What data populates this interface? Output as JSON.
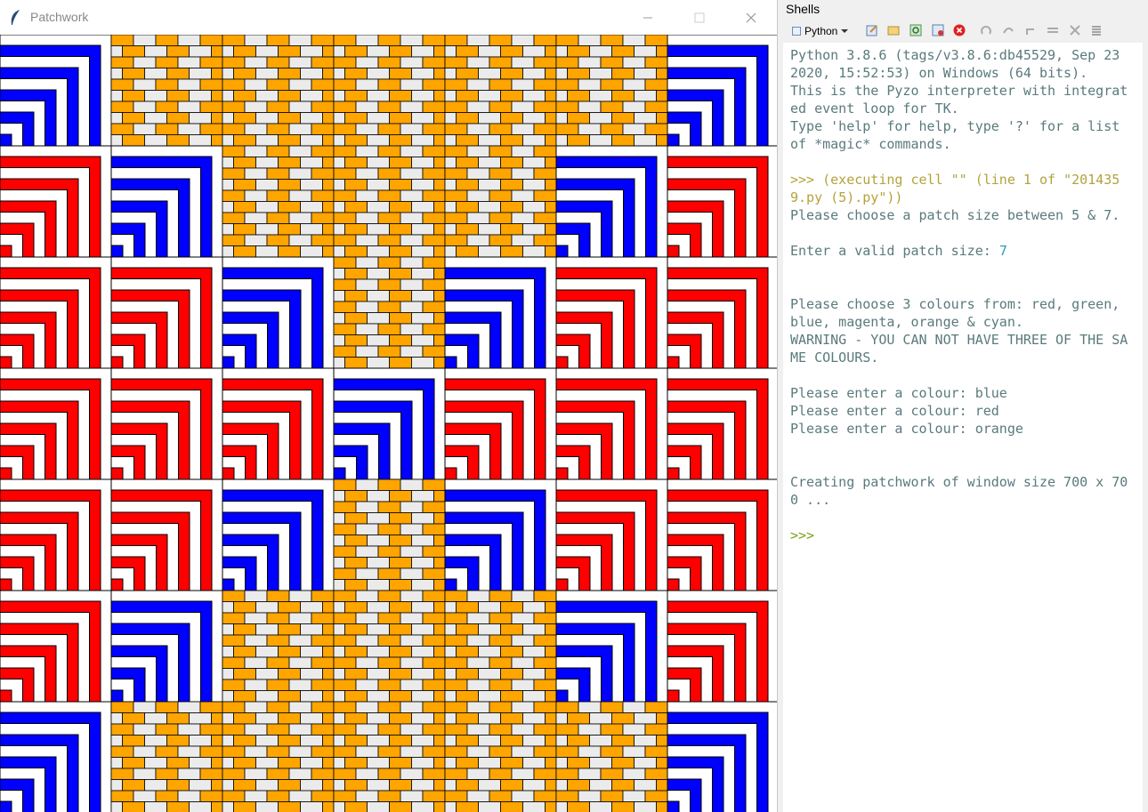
{
  "tk": {
    "title": "Patchwork",
    "controls": {
      "minimize": "—",
      "maximize": "☐",
      "close": "✕"
    }
  },
  "patchwork": {
    "rows": 7,
    "cols": 7,
    "colours": {
      "blue": "#0000ff",
      "red": "#ff0000",
      "orange": "#ffa500",
      "white": "#ffffff",
      "brick_light": "#ebebeb"
    },
    "layout": [
      [
        "L-blue",
        "B",
        "B",
        "B",
        "B",
        "B",
        "L-blue"
      ],
      [
        "L-red",
        "L-blue",
        "B",
        "B",
        "B",
        "L-blue",
        "L-red"
      ],
      [
        "L-red",
        "L-red",
        "L-blue",
        "B",
        "L-blue",
        "L-red",
        "L-red"
      ],
      [
        "L-red",
        "L-red",
        "L-red",
        "L-blue",
        "L-red",
        "L-red",
        "L-red"
      ],
      [
        "L-red",
        "L-red",
        "L-blue",
        "B",
        "L-blue",
        "L-red",
        "L-red"
      ],
      [
        "L-red",
        "L-blue",
        "B",
        "B",
        "B",
        "L-blue",
        "L-red"
      ],
      [
        "L-blue",
        "B",
        "B",
        "B",
        "B",
        "B",
        "L-blue"
      ]
    ]
  },
  "shells": {
    "title": "Shells",
    "shell_name": "Python",
    "toolbar_icons": [
      "edit-icon",
      "folder-icon",
      "refresh-icon",
      "new-shell-icon",
      "stop-icon",
      "interrupt-icon",
      "step-over-icon",
      "step-out-icon",
      "continue-icon",
      "clear-icon",
      "list-icon"
    ],
    "lines": [
      {
        "t": "Python 3.8.6 (tags/v3.8.6:db45529, Sep 23 2020, 15:52:53) on Windows (64 bits).",
        "c": ""
      },
      {
        "t": "This is the Pyzo interpreter with integrated event loop for TK.",
        "c": ""
      },
      {
        "t": "Type 'help' for help, type '?' for a list of *magic* commands.",
        "c": ""
      },
      {
        "t": "",
        "c": ""
      },
      {
        "t": ">>> (executing cell \"\" (line 1 of \"2014359.py (5).py\"))",
        "c": "exec"
      },
      {
        "t": "Please choose a patch size between 5 & 7.",
        "c": ""
      },
      {
        "t": "",
        "c": ""
      },
      {
        "t": "Enter a valid patch size: ",
        "c": "",
        "input": "7"
      },
      {
        "t": "",
        "c": ""
      },
      {
        "t": "",
        "c": ""
      },
      {
        "t": "Please choose 3 colours from: red, green, blue, magenta, orange & cyan.",
        "c": ""
      },
      {
        "t": "WARNING - YOU CAN NOT HAVE THREE OF THE SAME COLOURS.",
        "c": ""
      },
      {
        "t": "",
        "c": ""
      },
      {
        "t": "Please enter a colour: blue",
        "c": ""
      },
      {
        "t": "Please enter a colour: red",
        "c": ""
      },
      {
        "t": "Please enter a colour: orange",
        "c": ""
      },
      {
        "t": "",
        "c": ""
      },
      {
        "t": "",
        "c": ""
      },
      {
        "t": "Creating patchwork of window size 700 x 700 ...",
        "c": ""
      },
      {
        "t": "",
        "c": ""
      },
      {
        "t": ">>>",
        "c": "prompt"
      }
    ]
  }
}
